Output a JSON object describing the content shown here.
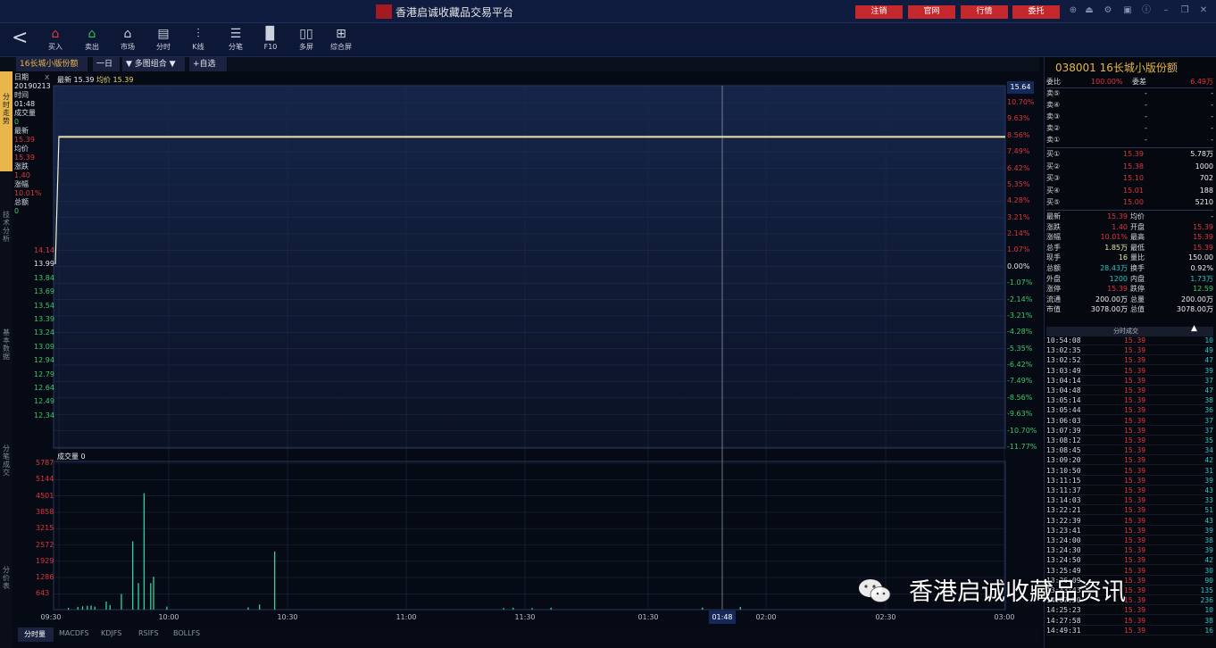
{
  "window": {
    "title": "香港启诚收藏品交易平台"
  },
  "top_buttons": [
    "注销",
    "官网",
    "行情",
    "委托"
  ],
  "toolbar": [
    {
      "icon": "buy-house-icon",
      "label": "买入",
      "color": "#e23b3b"
    },
    {
      "icon": "sell-house-icon",
      "label": "卖出",
      "color": "#2fbf52"
    },
    {
      "icon": "market-icon",
      "label": "市场",
      "color": "#ccd2e0"
    },
    {
      "icon": "timeshare-icon",
      "label": "分时",
      "color": "#ccd2e0"
    },
    {
      "icon": "kline-icon",
      "label": "K线",
      "color": "#ccd2e0"
    },
    {
      "icon": "tick-list-icon",
      "label": "分笔",
      "color": "#ccd2e0"
    },
    {
      "icon": "f10-doc-icon",
      "label": "F10",
      "color": "#ccd2e0"
    },
    {
      "icon": "multi-screen-icon",
      "label": "多屏",
      "color": "#ccd2e0"
    },
    {
      "icon": "composite-screen-icon",
      "label": "综合屏",
      "color": "#ccd2e0"
    }
  ],
  "tabs": {
    "symbol": "16长城小版份额",
    "period": "一日",
    "combo": "多图组合",
    "add": "+自选"
  },
  "left_tabs": [
    "分时走势",
    "技术分析",
    "基本数据",
    "分笔成交",
    "分价表"
  ],
  "info": {
    "date_label": "日期",
    "date": "20190213",
    "time_label": "时间",
    "time": "01:48",
    "vol_label": "成交量",
    "vol": "0",
    "last_label": "最新",
    "last": "15.39",
    "avg_label": "均价",
    "avg": "15.39",
    "chg_label": "涨跌",
    "chg": "1.40",
    "pct_label": "涨幅",
    "pct": "10.01%",
    "amt_label": "总额",
    "amt": "0"
  },
  "chart_legend": {
    "last": "最新 15.39",
    "avg": "均价 15.39"
  },
  "volume_legend": "成交量 0",
  "cursor": {
    "price": "15.64",
    "time": "01:48"
  },
  "axes": {
    "price_left": [
      "14.14",
      "13.99",
      "13.84",
      "13.69",
      "13.54",
      "13.39",
      "13.24",
      "13.09",
      "12.94",
      "12.79",
      "12.64",
      "12.49",
      "12.34"
    ],
    "pct_right": [
      "10.70%",
      "9.63%",
      "8.56%",
      "7.49%",
      "6.42%",
      "5.35%",
      "4.28%",
      "3.21%",
      "2.14%",
      "1.07%",
      "0.00%",
      "-1.07%",
      "-2.14%",
      "-3.21%",
      "-4.28%",
      "-5.35%",
      "-6.42%",
      "-7.49%",
      "-8.56%",
      "-9.63%",
      "-10.70%",
      "-11.77%"
    ],
    "vol_left": [
      "5787",
      "5144",
      "4501",
      "3858",
      "3215",
      "2572",
      "1929",
      "1286",
      "643"
    ],
    "time": [
      "09:30",
      "10:00",
      "10:30",
      "11:00",
      "11:30",
      "01:30",
      "02:00",
      "02:30",
      "03:00"
    ]
  },
  "chart_data": {
    "type": "line",
    "price_line": {
      "open_price": 13.99,
      "price": 15.39
    },
    "volume_bars": [
      {
        "t": 0.01,
        "v": 70
      },
      {
        "t": 0.02,
        "v": 110
      },
      {
        "t": 0.025,
        "v": 130
      },
      {
        "t": 0.03,
        "v": 150
      },
      {
        "t": 0.034,
        "v": 160
      },
      {
        "t": 0.038,
        "v": 120
      },
      {
        "t": 0.05,
        "v": 320
      },
      {
        "t": 0.054,
        "v": 180
      },
      {
        "t": 0.066,
        "v": 620
      },
      {
        "t": 0.078,
        "v": 2700
      },
      {
        "t": 0.084,
        "v": 1050
      },
      {
        "t": 0.09,
        "v": 4600
      },
      {
        "t": 0.097,
        "v": 1050
      },
      {
        "t": 0.1,
        "v": 1300
      },
      {
        "t": 0.114,
        "v": 120
      },
      {
        "t": 0.2,
        "v": 90
      },
      {
        "t": 0.212,
        "v": 200
      },
      {
        "t": 0.228,
        "v": 2300
      },
      {
        "t": 0.47,
        "v": 60
      },
      {
        "t": 0.48,
        "v": 70
      },
      {
        "t": 0.5,
        "v": 60
      },
      {
        "t": 0.52,
        "v": 70
      },
      {
        "t": 0.68,
        "v": 80
      },
      {
        "t": 0.72,
        "v": 110
      }
    ],
    "vol_max": 5787
  },
  "side": {
    "title": "038001 16长城小版份额",
    "webi": {
      "l1": "委比",
      "v1": "100.00%",
      "l2": "委差",
      "v2": "6.49万"
    },
    "sell": [
      {
        "label": "卖⑤",
        "price": "-",
        "vol": "-"
      },
      {
        "label": "卖④",
        "price": "-",
        "vol": "-"
      },
      {
        "label": "卖③",
        "price": "-",
        "vol": "-"
      },
      {
        "label": "卖②",
        "price": "-",
        "vol": "-"
      },
      {
        "label": "卖①",
        "price": "-",
        "vol": "-"
      }
    ],
    "buy": [
      {
        "label": "买①",
        "price": "15.39",
        "vol": "5.78万"
      },
      {
        "label": "买②",
        "price": "15.38",
        "vol": "1000"
      },
      {
        "label": "买③",
        "price": "15.10",
        "vol": "702"
      },
      {
        "label": "买④",
        "price": "15.01",
        "vol": "188"
      },
      {
        "label": "买⑤",
        "price": "15.00",
        "vol": "5210"
      }
    ],
    "stats": [
      {
        "l1": "最新",
        "v1": "15.39",
        "c1": "#e0353d",
        "l2": "均价",
        "v2": "-",
        "c2": "#d4d8e0"
      },
      {
        "l1": "涨跌",
        "v1": "1.40",
        "c1": "#e0353d",
        "l2": "开盘",
        "v2": "15.39",
        "c2": "#e0353d"
      },
      {
        "l1": "涨幅",
        "v1": "10.01%",
        "c1": "#e0353d",
        "l2": "最高",
        "v2": "15.39",
        "c2": "#e0353d"
      },
      {
        "l1": "总手",
        "v1": "1.85万",
        "c1": "#e8e8a0",
        "l2": "最低",
        "v2": "15.39",
        "c2": "#e0353d"
      },
      {
        "l1": "现手",
        "v1": "16",
        "c1": "#e8e8a0",
        "l2": "量比",
        "v2": "150.00",
        "c2": "#f0f0f0"
      },
      {
        "l1": "总额",
        "v1": "28.43万",
        "c1": "#28c8c8",
        "l2": "换手",
        "v2": "0.92%",
        "c2": "#f0f0f0"
      },
      {
        "l1": "外盘",
        "v1": "1200",
        "c1": "#28c8c8",
        "l2": "内盘",
        "v2": "1.73万",
        "c2": "#28c8c8"
      },
      {
        "l1": "涨停",
        "v1": "15.39",
        "c1": "#e0353d",
        "l2": "跌停",
        "v2": "12.59",
        "c2": "#3cc86c"
      },
      {
        "l1": "流通",
        "v1": "200.00万",
        "c1": "#f0f0f0",
        "l2": "总量",
        "v2": "200.00万",
        "c2": "#f0f0f0"
      },
      {
        "l1": "市值",
        "v1": "3078.00万",
        "c1": "#f0f0f0",
        "l2": "总值",
        "v2": "3078.00万",
        "c2": "#f0f0f0"
      }
    ],
    "trades_header": "分时成交",
    "trades": [
      {
        "t": "10:54:08",
        "p": "15.39",
        "v": "10"
      },
      {
        "t": "13:02:35",
        "p": "15.39",
        "v": "49"
      },
      {
        "t": "13:02:52",
        "p": "15.39",
        "v": "47"
      },
      {
        "t": "13:03:49",
        "p": "15.39",
        "v": "39"
      },
      {
        "t": "13:04:14",
        "p": "15.39",
        "v": "37"
      },
      {
        "t": "13:04:48",
        "p": "15.39",
        "v": "47"
      },
      {
        "t": "13:05:14",
        "p": "15.39",
        "v": "38"
      },
      {
        "t": "13:05:44",
        "p": "15.39",
        "v": "36"
      },
      {
        "t": "13:06:03",
        "p": "15.39",
        "v": "37"
      },
      {
        "t": "13:07:39",
        "p": "15.39",
        "v": "37"
      },
      {
        "t": "13:08:12",
        "p": "15.39",
        "v": "35"
      },
      {
        "t": "13:08:45",
        "p": "15.39",
        "v": "34"
      },
      {
        "t": "13:09:20",
        "p": "15.39",
        "v": "42"
      },
      {
        "t": "13:10:50",
        "p": "15.39",
        "v": "31"
      },
      {
        "t": "13:11:15",
        "p": "15.39",
        "v": "39"
      },
      {
        "t": "13:11:37",
        "p": "15.39",
        "v": "43"
      },
      {
        "t": "13:14:03",
        "p": "15.39",
        "v": "33"
      },
      {
        "t": "13:22:21",
        "p": "15.39",
        "v": "51"
      },
      {
        "t": "13:22:39",
        "p": "15.39",
        "v": "43"
      },
      {
        "t": "13:23:41",
        "p": "15.39",
        "v": "39"
      },
      {
        "t": "13:24:00",
        "p": "15.39",
        "v": "38"
      },
      {
        "t": "13:24:30",
        "p": "15.39",
        "v": "39"
      },
      {
        "t": "13:24:50",
        "p": "15.39",
        "v": "42"
      },
      {
        "t": "13:25:49",
        "p": "15.39",
        "v": "30"
      },
      {
        "t": "13:26:09",
        "p": "15.39",
        "v": "90"
      },
      {
        "t": "13:43:43",
        "p": "15.39",
        "v": "135"
      },
      {
        "t": "14:07:50",
        "p": "15.39",
        "v": "236"
      },
      {
        "t": "14:25:23",
        "p": "15.39",
        "v": "10"
      },
      {
        "t": "14:27:58",
        "p": "15.39",
        "v": "38"
      },
      {
        "t": "14:49:31",
        "p": "15.39",
        "v": "16"
      }
    ]
  },
  "bottom_tabs": [
    "分时量",
    "MACDFS",
    "KDJFS",
    "RSIFS",
    "BOLLFS"
  ],
  "watermark": "香港启诚收藏品资讯",
  "colors": {
    "up": "#e0353d",
    "down": "#3cc86c",
    "price_line": "#f0f0d0",
    "volume": "#2fd4a0",
    "accent": "#e8b64a"
  }
}
